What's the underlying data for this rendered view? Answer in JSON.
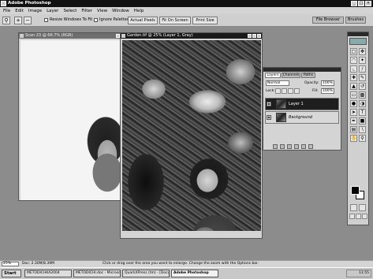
{
  "window": {
    "title": "Adobe Photoshop",
    "controls": [
      "_",
      "□",
      "×"
    ]
  },
  "menu": [
    "File",
    "Edit",
    "Image",
    "Layer",
    "Select",
    "Filter",
    "View",
    "Window",
    "Help"
  ],
  "options": {
    "zoom_in_icon": "magnifier-plus",
    "zoom_out_icon": "magnifier-minus",
    "resize_windows_label": "Resize Windows To Fit",
    "ignore_palettes_label": "Ignore Palettes",
    "actual_pixels_label": "Actual Pixels",
    "fit_on_screen_label": "Fit On Screen",
    "print_size_label": "Print Size",
    "tab_filebrowser": "File Browser",
    "tab_brushes": "Brushes"
  },
  "documents": [
    {
      "title": "Scan 23 @ 66.7% (RGB)"
    },
    {
      "title": "Garden.tif @ 25% (Layer 1, Gray)"
    }
  ],
  "layers_panel": {
    "tabs": [
      "Layers",
      "Channels",
      "Paths"
    ],
    "blend_mode": "Normal",
    "opacity_label": "Opacity:",
    "opacity_value": "100%",
    "lock_label": "Lock:",
    "fill_label": "Fill:",
    "fill_value": "100%",
    "layers": [
      {
        "name": "Layer 1",
        "selected": true
      },
      {
        "name": "Background",
        "selected": false
      }
    ]
  },
  "status": {
    "zoom": "25%",
    "doc": "Doc: 2.30M/8.39M",
    "hint": "Click or drag over the area you want to enlarge. Change the zoom with the Options bar."
  },
  "taskbar": {
    "start": "Start",
    "tasks": [
      "METODICHKA2004",
      "METODICHI.doc - Microsoft",
      "QuarkXPress (tm) - [Docu...]",
      "Adobe Photoshop"
    ],
    "time": "11:55"
  }
}
